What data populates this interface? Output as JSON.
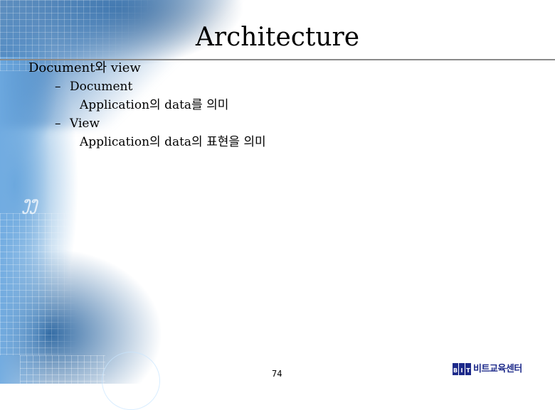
{
  "slide": {
    "title": "Architecture",
    "page_number": "74"
  },
  "content": {
    "heading": "Document와 view",
    "items": [
      {
        "bullet": "–",
        "label": "Document",
        "description": "Application의 data를 의미"
      },
      {
        "bullet": "–",
        "label": "View",
        "description": "Application의 data의 표현을 의미"
      }
    ]
  },
  "logo": {
    "letters": [
      "B",
      "I",
      "T"
    ],
    "text": "비트교육센터",
    "color": "#1d2a8a"
  },
  "colors": {
    "title_rule": "#8a8a8a",
    "background_accent": "#3f7fbf"
  }
}
